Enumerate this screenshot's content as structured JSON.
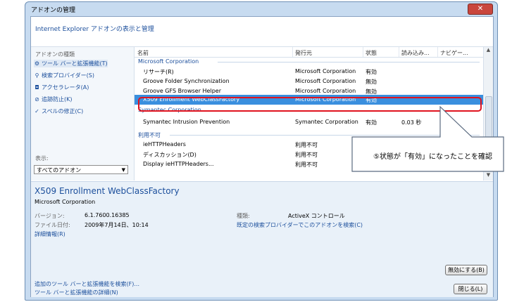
{
  "window": {
    "title": "アドオンの管理",
    "close_glyph": "✕"
  },
  "header": {
    "title": "Internet Explorer アドオンの表示と管理"
  },
  "left": {
    "types_label": "アドオンの種類",
    "items": [
      {
        "label": "ツール バーと拡張機能(T)",
        "icon": "gear-icon"
      },
      {
        "label": "検索プロバイダー(S)",
        "icon": "search-icon"
      },
      {
        "label": "アクセラレータ(A)",
        "icon": "accelerator-icon"
      },
      {
        "label": "追跡防止(K)",
        "icon": "block-icon"
      },
      {
        "label": "スペルの修正(C)",
        "icon": "spellcheck-icon"
      }
    ],
    "display_label": "表示:",
    "display_value": "すべてのアドオン"
  },
  "columns": {
    "name": "名前",
    "publisher": "発行元",
    "status": "状態",
    "load": "読み込み...",
    "nav": "ナビゲー..."
  },
  "groups": [
    {
      "name": "Microsoft Corporation",
      "rows": [
        {
          "name": "リサーチ(R)",
          "publisher": "Microsoft Corporation",
          "status": "有効",
          "load": ""
        },
        {
          "name": "Groove Folder Synchronization",
          "publisher": "Microsoft Corporation",
          "status": "無効",
          "load": ""
        },
        {
          "name": "Groove GFS Browser Helper",
          "publisher": "Microsoft Corporation",
          "status": "無効",
          "load": ""
        },
        {
          "name": "X509 Enrollment WebClassFactory",
          "publisher": "Microsoft Corporation",
          "status": "有効",
          "load": ""
        }
      ]
    },
    {
      "name": "Symantec Corporation",
      "rows": [
        {
          "name": "Symantec Intrusion Prevention",
          "publisher": "Symantec Corporation",
          "status": "有効",
          "load": "0.03 秒"
        }
      ]
    },
    {
      "name": "利用不可",
      "rows": [
        {
          "name": "ieHTTPHeaders",
          "publisher": "利用不可",
          "status": "",
          "load": ""
        },
        {
          "name": "ディスカッション(D)",
          "publisher": "利用不可",
          "status": "",
          "load": ""
        },
        {
          "name": "Display ieHTTPHeaders...",
          "publisher": "利用不可",
          "status": "",
          "load": ""
        }
      ]
    }
  ],
  "detail": {
    "name": "X509 Enrollment WebClassFactory",
    "publisher": "Microsoft Corporation",
    "version_label": "バージョン:",
    "version_value": "6.1.7600.16385",
    "date_label": "ファイル日付:",
    "date_value": "2009年7月14日、10:14",
    "more_info": "詳細情報(R)",
    "type_label": "種類:",
    "type_value": "ActiveX コントロール",
    "search_link": "既定の検索プロバイダーでこのアドオンを検索(C)"
  },
  "footer": {
    "find_more": "追加のツール バーと拡張機能を検索(F)...",
    "learn_more": "ツール バーと拡張機能の詳細(N)",
    "disable_btn": "無効にする(B)",
    "close_btn": "閉じる(L)"
  },
  "annotation": {
    "text": "⑤状態が「有効」になったことを確認",
    "color": "#e0121e"
  }
}
